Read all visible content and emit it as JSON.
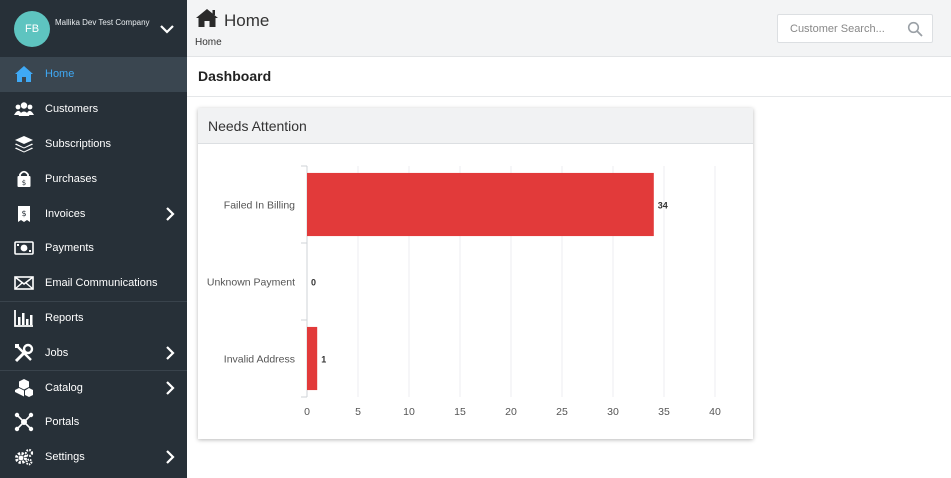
{
  "sidebar": {
    "avatar_initials": "FB",
    "company_name": "Mallika Dev Test Company",
    "items": [
      {
        "label": "Home",
        "icon": "home-icon",
        "active": true,
        "chevron": false
      },
      {
        "label": "Customers",
        "icon": "users-icon",
        "active": false,
        "chevron": false
      },
      {
        "label": "Subscriptions",
        "icon": "layers-icon",
        "active": false,
        "chevron": false
      },
      {
        "label": "Purchases",
        "icon": "shopping-bag-icon",
        "active": false,
        "chevron": false
      },
      {
        "label": "Invoices",
        "icon": "invoice-icon",
        "active": false,
        "chevron": true
      },
      {
        "label": "Payments",
        "icon": "money-icon",
        "active": false,
        "chevron": false
      },
      {
        "label": "Email Communications",
        "icon": "envelope-icon",
        "active": false,
        "chevron": false
      },
      {
        "label": "Reports",
        "icon": "bar-chart-icon",
        "active": false,
        "chevron": false
      },
      {
        "label": "Jobs",
        "icon": "tools-icon",
        "active": false,
        "chevron": true
      },
      {
        "label": "Catalog",
        "icon": "cubes-icon",
        "active": false,
        "chevron": true
      },
      {
        "label": "Portals",
        "icon": "network-icon",
        "active": false,
        "chevron": false
      },
      {
        "label": "Settings",
        "icon": "gears-icon",
        "active": false,
        "chevron": true
      }
    ]
  },
  "header": {
    "title": "Home",
    "breadcrumb": "Home",
    "search_placeholder": "Customer Search..."
  },
  "main": {
    "dashboard_title": "Dashboard",
    "card_title": "Needs Attention"
  },
  "colors": {
    "sidebar_bg": "#273038",
    "active_text": "#3fa9f5",
    "bar": "#e23a3a"
  },
  "chart_data": {
    "type": "bar",
    "orientation": "horizontal",
    "categories": [
      "Failed In Billing",
      "Unknown Payment",
      "Invalid Address"
    ],
    "values": [
      34,
      0,
      1
    ],
    "xlim": [
      0,
      40
    ],
    "xticks": [
      0,
      5,
      10,
      15,
      20,
      25,
      30,
      35,
      40
    ],
    "grid": true
  }
}
